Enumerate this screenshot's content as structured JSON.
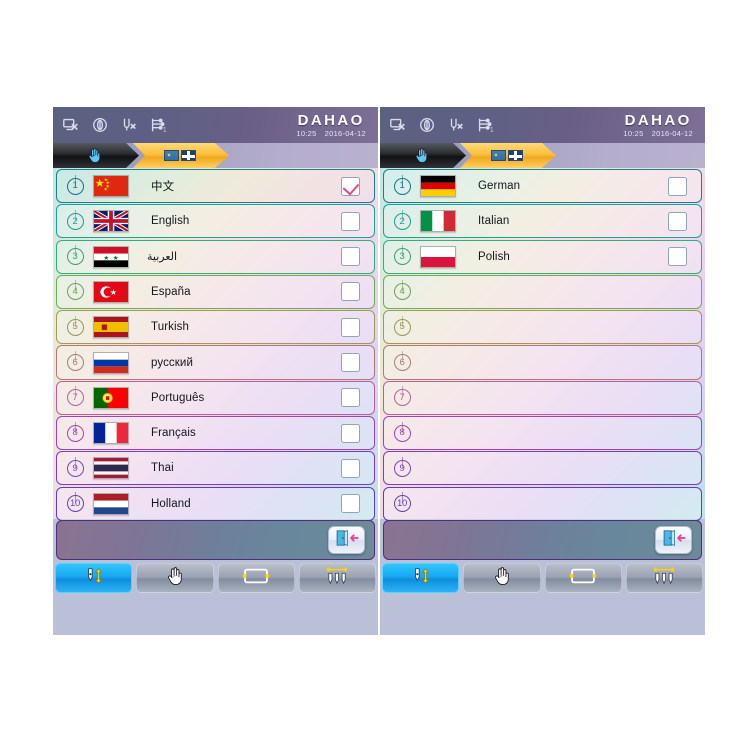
{
  "device": {
    "brand": "DAHAO",
    "time": "10:25",
    "date": "2016-04-12"
  },
  "status_icons": [
    {
      "name": "machine-stop-icon"
    },
    {
      "name": "oil-shuttle-icon"
    },
    {
      "name": "needle-break-icon"
    },
    {
      "name": "thread-trim-1-icon"
    }
  ],
  "breadcrumb": [
    {
      "name": "manual-operation-crumb",
      "icon": "hand-pointer-icon"
    },
    {
      "name": "language-select-crumb",
      "icon": "flags-icon",
      "active": true
    }
  ],
  "panels": [
    {
      "id": "left-panel",
      "rows": [
        {
          "index": "1",
          "flag": "china",
          "label": "中文",
          "checked": true,
          "rtl": false,
          "empty": false
        },
        {
          "index": "2",
          "flag": "uk",
          "label": "English",
          "checked": false,
          "rtl": false,
          "empty": false
        },
        {
          "index": "3",
          "flag": "syria",
          "label": "العربية",
          "checked": false,
          "rtl": true,
          "empty": false
        },
        {
          "index": "4",
          "flag": "turkey",
          "label": "España",
          "checked": false,
          "rtl": false,
          "empty": false
        },
        {
          "index": "5",
          "flag": "spain",
          "label": "Turkish",
          "checked": false,
          "rtl": false,
          "empty": false
        },
        {
          "index": "6",
          "flag": "russia",
          "label": "русский",
          "checked": false,
          "rtl": false,
          "empty": false
        },
        {
          "index": "7",
          "flag": "portugal",
          "label": "Português",
          "checked": false,
          "rtl": false,
          "empty": false
        },
        {
          "index": "8",
          "flag": "france",
          "label": "Français",
          "checked": false,
          "rtl": false,
          "empty": false
        },
        {
          "index": "9",
          "flag": "thailand",
          "label": "Thai",
          "checked": false,
          "rtl": false,
          "empty": false
        },
        {
          "index": "10",
          "flag": "holland",
          "label": "Holland",
          "checked": false,
          "rtl": false,
          "empty": false
        }
      ]
    },
    {
      "id": "right-panel",
      "rows": [
        {
          "index": "1",
          "flag": "germany",
          "label": "German",
          "checked": false,
          "rtl": false,
          "empty": false
        },
        {
          "index": "2",
          "flag": "italy",
          "label": "Italian",
          "checked": false,
          "rtl": false,
          "empty": false
        },
        {
          "index": "3",
          "flag": "poland",
          "label": "Polish",
          "checked": false,
          "rtl": false,
          "empty": false
        },
        {
          "index": "4",
          "flag": "",
          "label": "",
          "checked": false,
          "rtl": false,
          "empty": true
        },
        {
          "index": "5",
          "flag": "",
          "label": "",
          "checked": false,
          "rtl": false,
          "empty": true
        },
        {
          "index": "6",
          "flag": "",
          "label": "",
          "checked": false,
          "rtl": false,
          "empty": true
        },
        {
          "index": "7",
          "flag": "",
          "label": "",
          "checked": false,
          "rtl": false,
          "empty": true
        },
        {
          "index": "8",
          "flag": "",
          "label": "",
          "checked": false,
          "rtl": false,
          "empty": true
        },
        {
          "index": "9",
          "flag": "",
          "label": "",
          "checked": false,
          "rtl": false,
          "empty": true
        },
        {
          "index": "10",
          "flag": "",
          "label": "",
          "checked": false,
          "rtl": false,
          "empty": true
        }
      ]
    }
  ],
  "action_strip": {
    "exit_button": {
      "name": "exit-button",
      "icon": "door-exit-icon"
    }
  },
  "toolbar": [
    {
      "name": "needle-updown-button",
      "icon": "needle-up-down-icon",
      "active": true
    },
    {
      "name": "manual-hand-button",
      "icon": "hand-pointer-icon",
      "active": false
    },
    {
      "name": "frame-border-button",
      "icon": "frame-rectangle-icon",
      "active": false
    },
    {
      "name": "multi-needle-button",
      "icon": "three-needles-icon",
      "active": false
    }
  ],
  "colors": {
    "accent_amber": "#f0a81c",
    "accent_blue": "#17a7f0",
    "check_pink": "#e8467f",
    "status_bar": "#5d6084"
  }
}
